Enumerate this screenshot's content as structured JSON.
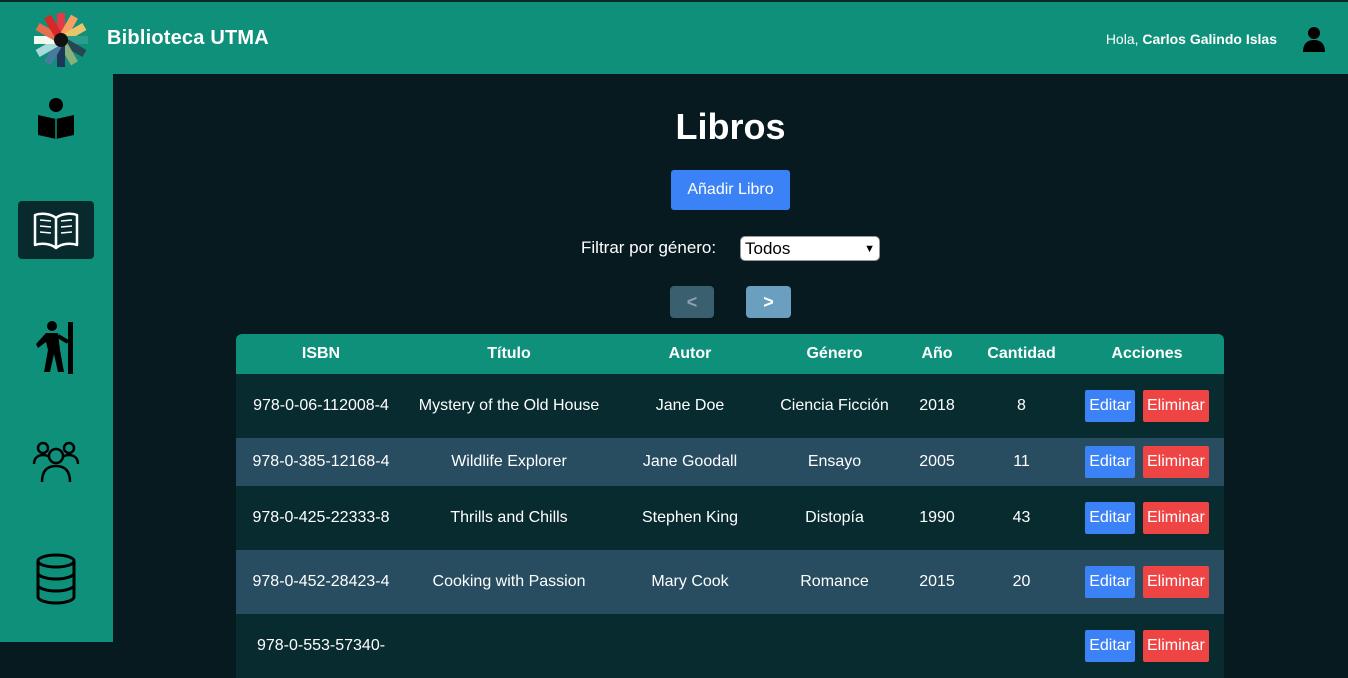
{
  "header": {
    "brand": "Biblioteca UTMA",
    "greeting_prefix": "Hola,",
    "user_name": "Carlos Galindo Islas"
  },
  "sidebar": {
    "items": [
      {
        "icon": "reader-icon",
        "active": false
      },
      {
        "icon": "open-book-icon",
        "active": true
      },
      {
        "icon": "hiker-icon",
        "active": false
      },
      {
        "icon": "users-icon",
        "active": false
      },
      {
        "icon": "database-icon",
        "active": false
      }
    ]
  },
  "main": {
    "title": "Libros",
    "add_button": "Añadir Libro",
    "filter_label": "Filtrar por género:",
    "filter_value": "Todos",
    "prev_label": "<",
    "next_label": ">"
  },
  "table": {
    "headers": [
      "ISBN",
      "Título",
      "Autor",
      "Género",
      "Año",
      "Cantidad",
      "Acciones"
    ],
    "edit_label": "Editar",
    "delete_label": "Eliminar",
    "rows": [
      {
        "isbn": "978-0-06-112008-4",
        "titulo": "Mystery of the Old House",
        "autor": "Jane Doe",
        "genero": "Ciencia Ficción",
        "anio": "2018",
        "cantidad": "8"
      },
      {
        "isbn": "978-0-385-12168-4",
        "titulo": "Wildlife Explorer",
        "autor": "Jane Goodall",
        "genero": "Ensayo",
        "anio": "2005",
        "cantidad": "11"
      },
      {
        "isbn": "978-0-425-22333-8",
        "titulo": "Thrills and Chills",
        "autor": "Stephen King",
        "genero": "Distopía",
        "anio": "1990",
        "cantidad": "43"
      },
      {
        "isbn": "978-0-452-28423-4",
        "titulo": "Cooking with Passion",
        "autor": "Mary Cook",
        "genero": "Romance",
        "anio": "2015",
        "cantidad": "20"
      },
      {
        "isbn": "978-0-553-57340-",
        "titulo": "",
        "autor": "",
        "genero": "",
        "anio": "",
        "cantidad": ""
      }
    ]
  },
  "colors": {
    "header_bg": "#0e907b",
    "main_bg": "#061a1f",
    "row_dark": "#082b30",
    "row_light": "#284c60",
    "primary": "#3b82f6",
    "danger": "#ef4444"
  }
}
